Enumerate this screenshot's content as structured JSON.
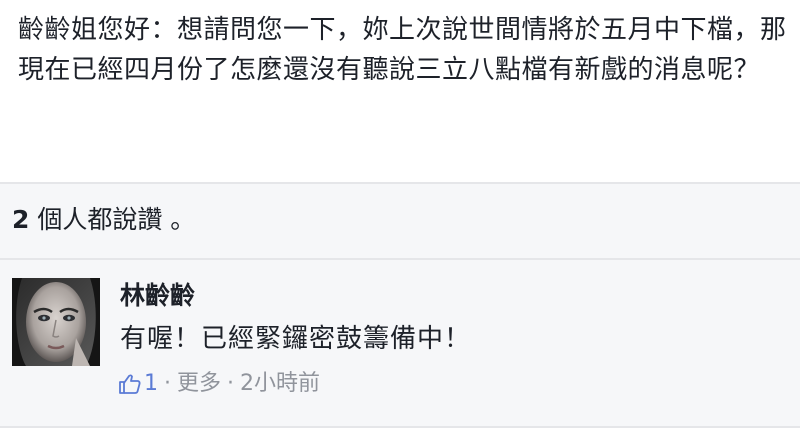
{
  "post": {
    "text": "齡齡姐您好：想請問您一下，妳上次說世間情將於五月中下檔，那現在已經四月份了怎麼還沒有聽說三立八點檔有新戲的消息呢？"
  },
  "likes": {
    "count": "2",
    "text": " 個人都說讚 。"
  },
  "comment": {
    "author": "林齡齡",
    "body": "有喔！已經緊鑼密鼓籌備中！",
    "like_count": "1",
    "more_label": "更多",
    "timestamp": "2小時前",
    "separator": "·"
  },
  "icons": {
    "like": "thumbs-up-icon"
  },
  "colors": {
    "link_blue": "#5b7bd5",
    "meta_gray": "#90949c",
    "panel_bg": "#f6f7f9"
  }
}
